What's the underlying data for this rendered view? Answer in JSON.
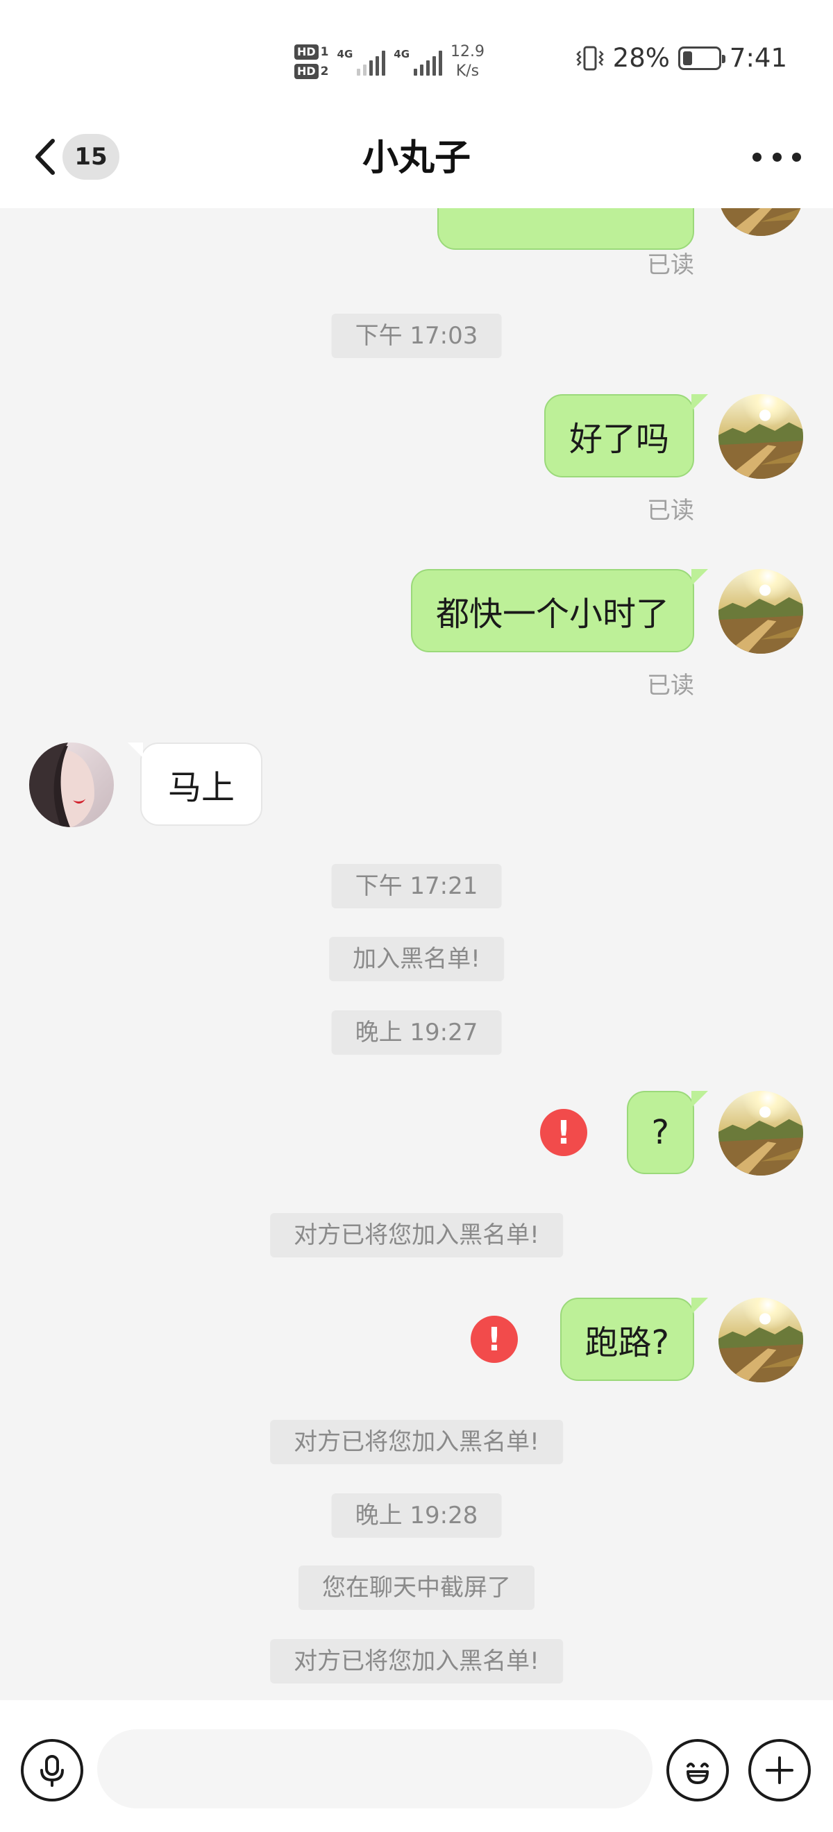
{
  "status_bar": {
    "hd1": "HD",
    "hd1_num": "1",
    "hd2": "HD",
    "hd2_num": "2",
    "net1": "4G",
    "net2": "4G",
    "speed_value": "12.9",
    "speed_unit": "K/s",
    "battery": "28%",
    "battery_level": 0.28,
    "time": "7:41",
    "icons": [
      "vibrate-icon",
      "battery-icon",
      "signal-icon"
    ]
  },
  "header": {
    "title": "小丸子",
    "unread_count": "15",
    "icons": [
      "back-arrow-icon",
      "more-icon"
    ]
  },
  "messages": {
    "read_label_top": "已读",
    "time_1": "下午 17:03",
    "msg_1": "好了吗",
    "read_1": "已读",
    "msg_2": "都快一个小时了",
    "read_2": "已读",
    "msg_3": "马上",
    "time_2": "下午 17:21",
    "sys_1": "加入黑名单!",
    "time_3": "晚上 19:27",
    "msg_4": "?",
    "sys_2": "对方已将您加入黑名单!",
    "msg_5": "跑路?",
    "sys_3": "对方已将您加入黑名单!",
    "time_4": "晚上 19:28",
    "sys_4": "您在聊天中截屏了",
    "sys_5": "对方已将您加入黑名单!",
    "fail_mark": "!"
  },
  "input_bar": {
    "placeholder": "",
    "icons": [
      "microphone-icon",
      "emoji-icon",
      "plus-icon"
    ]
  },
  "colors": {
    "bubble_out": "#bdf098",
    "bubble_in": "#ffffff",
    "fail": "#f24b4b",
    "background": "#f4f4f4"
  }
}
